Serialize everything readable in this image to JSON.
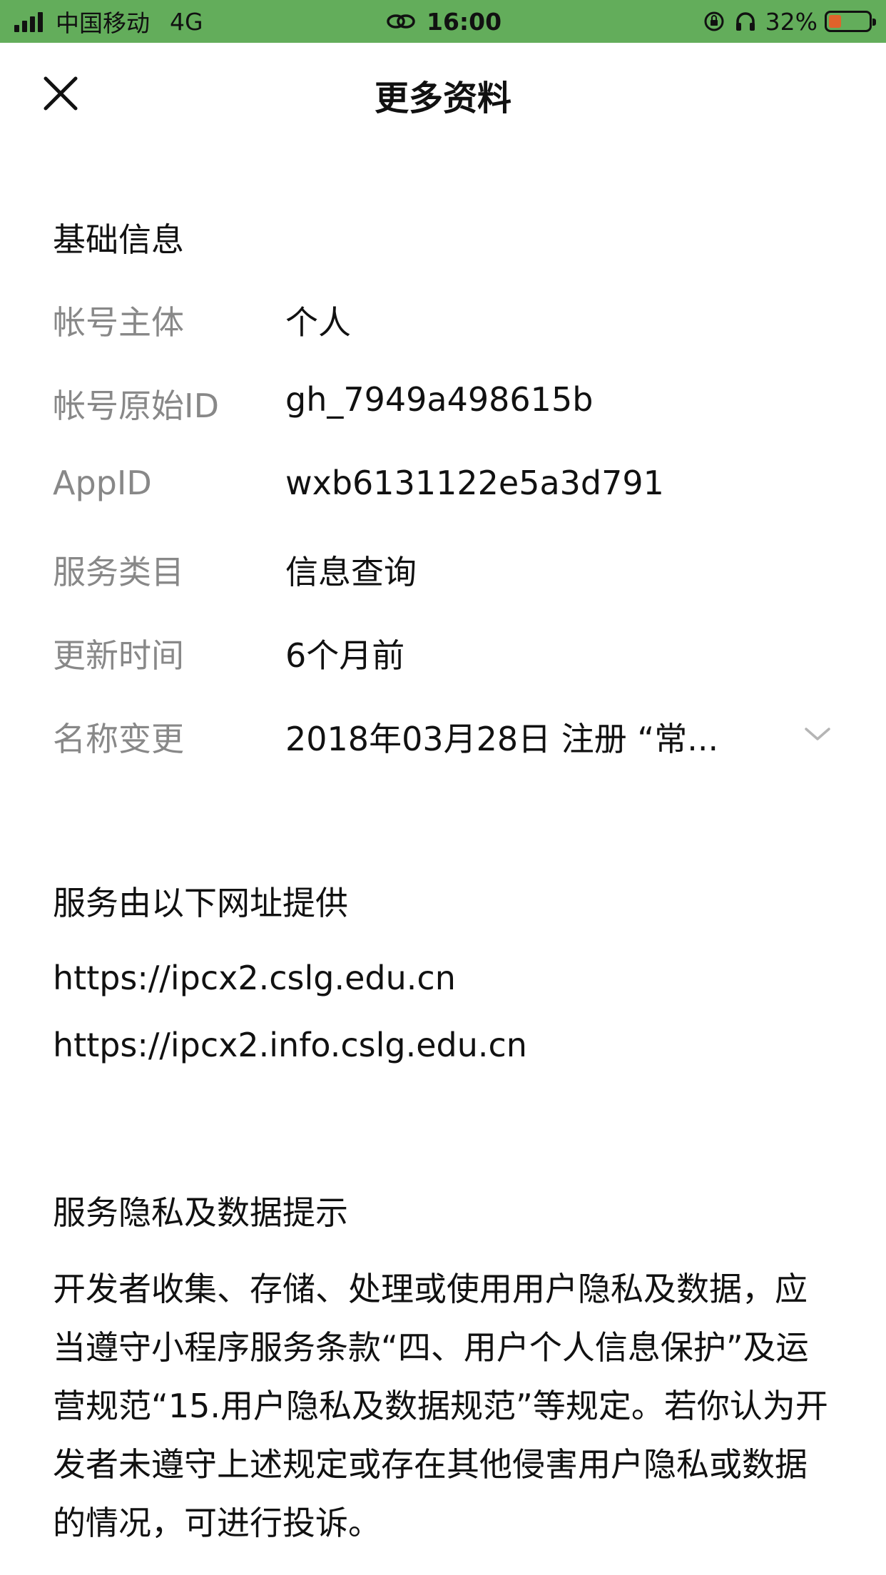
{
  "status_bar": {
    "carrier": "中国移动",
    "network": "4G",
    "time": "16:00",
    "battery_percent_text": "32%",
    "battery_level": 0.32,
    "background_color": "#63ad5b",
    "battery_color": "#e0632b"
  },
  "nav": {
    "title": "更多资料",
    "close_icon": "close-icon"
  },
  "basic_info": {
    "section_title": "基础信息",
    "rows": [
      {
        "label": "帐号主体",
        "value": "个人"
      },
      {
        "label": "帐号原始ID",
        "value": "gh_7949a498615b"
      },
      {
        "label": "AppID",
        "value": "wxb6131122e5a3d791"
      },
      {
        "label": "服务类目",
        "value": "信息查询"
      },
      {
        "label": "更新时间",
        "value": "6个月前"
      },
      {
        "label": "名称变更",
        "value": "2018年03月28日 注册 “常..."
      }
    ]
  },
  "service_urls": {
    "section_title": "服务由以下网址提供",
    "urls": [
      "https://ipcx2.cslg.edu.cn",
      "https://ipcx2.info.cslg.edu.cn"
    ]
  },
  "privacy": {
    "section_title": "服务隐私及数据提示",
    "text": "开发者收集、存储、处理或使用用户隐私及数据，应当遵守小程序服务条款“四、用户个人信息保护”及运营规范“15.用户隐私及数据规范”等规定。若你认为开发者未遵守上述规定或存在其他侵害用户隐私或数据的情况，可进行投诉。"
  }
}
